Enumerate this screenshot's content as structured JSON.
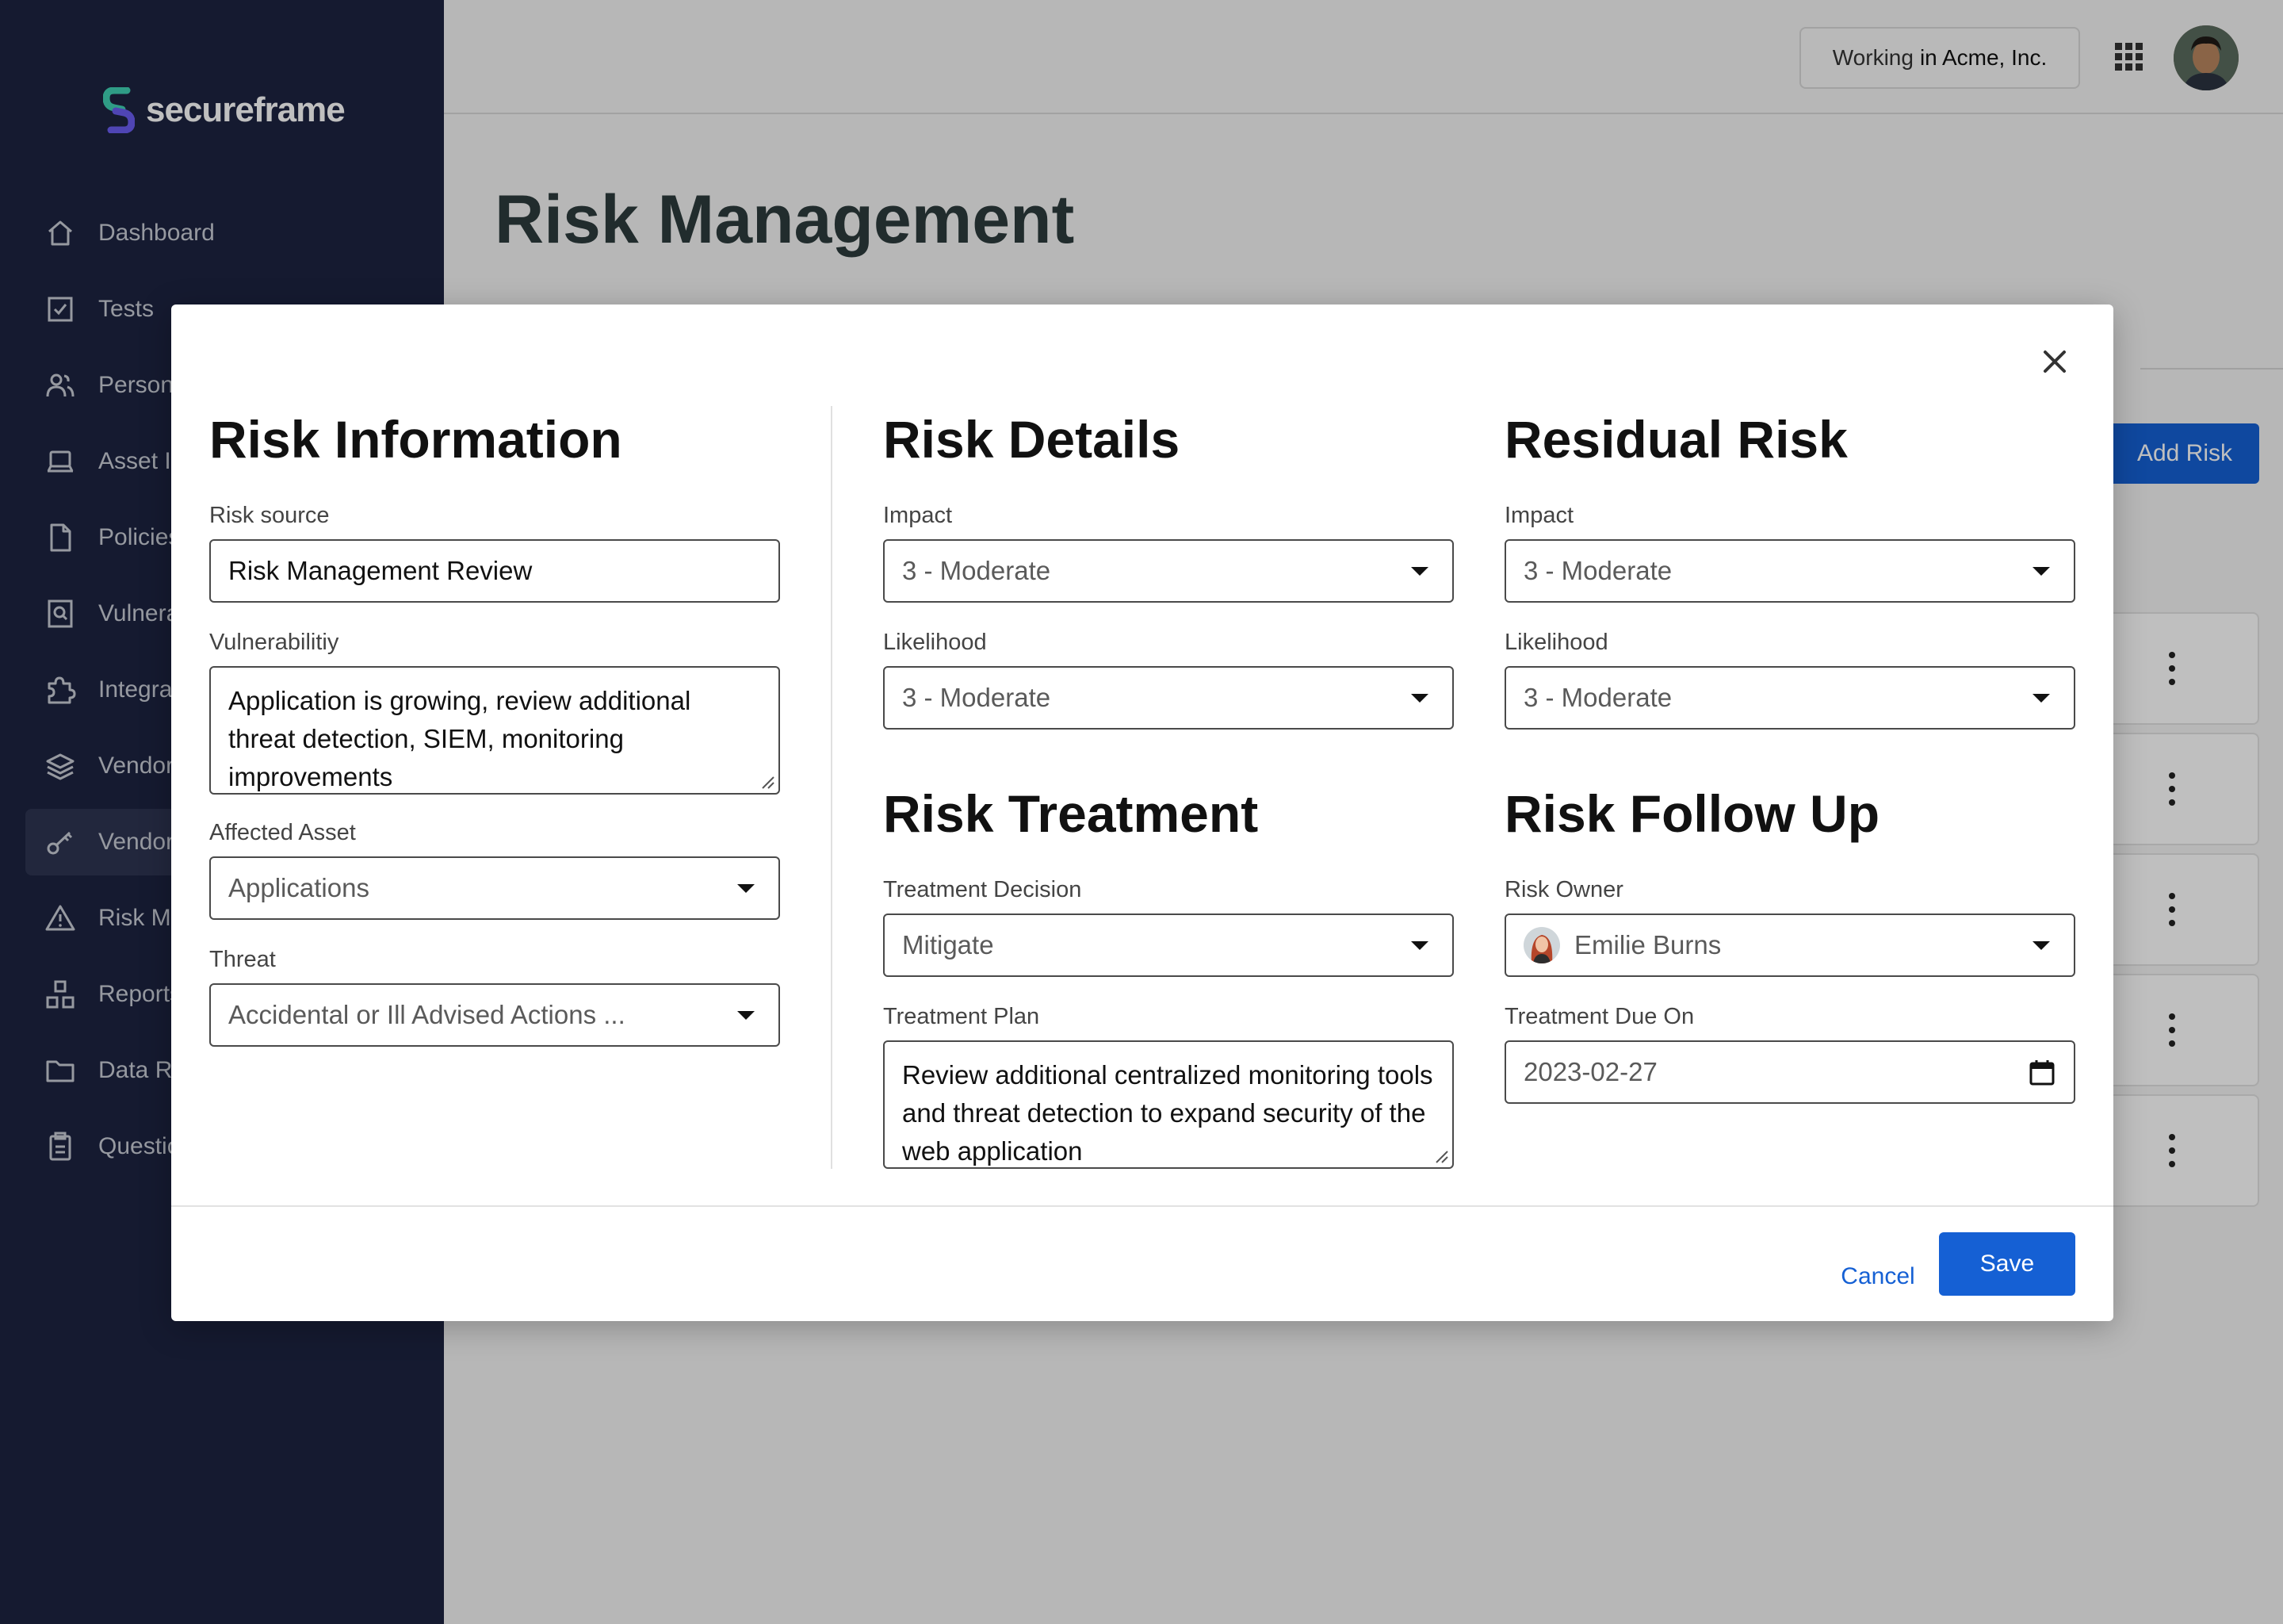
{
  "app": {
    "logo_text": "secureframe"
  },
  "sidebar": {
    "items": [
      {
        "label": "Dashboard"
      },
      {
        "label": "Tests"
      },
      {
        "label": "Personn"
      },
      {
        "label": "Asset In"
      },
      {
        "label": "Policies"
      },
      {
        "label": "Vulnera"
      },
      {
        "label": "Integra"
      },
      {
        "label": "Vendor"
      },
      {
        "label": "Vendor",
        "active": true
      },
      {
        "label": "Risk Ma"
      },
      {
        "label": "Reports"
      },
      {
        "label": "Data Ro"
      },
      {
        "label": "Questio"
      }
    ]
  },
  "header": {
    "workspace_prefix": "Working",
    "workspace_name": "in Acme, Inc."
  },
  "page": {
    "title": "Risk Management",
    "add_risk_label": "Add Risk"
  },
  "modal": {
    "risk_information": {
      "title": "Risk Information",
      "risk_source_label": "Risk source",
      "risk_source_value": "Risk Management Review",
      "vulnerability_label": "Vulnerabilitiy",
      "vulnerability_value": "Application is growing, review additional threat detection, SIEM, monitoring improvements",
      "affected_asset_label": "Affected Asset",
      "affected_asset_value": "Applications",
      "threat_label": "Threat",
      "threat_value": "Accidental or Ill Advised Actions ..."
    },
    "risk_details": {
      "title": "Risk Details",
      "impact_label": "Impact",
      "impact_value": "3 - Moderate",
      "likelihood_label": "Likelihood",
      "likelihood_value": "3 - Moderate"
    },
    "residual_risk": {
      "title": "Residual Risk",
      "impact_label": "Impact",
      "impact_value": "3 - Moderate",
      "likelihood_label": "Likelihood",
      "likelihood_value": "3 - Moderate"
    },
    "risk_treatment": {
      "title": "Risk Treatment",
      "decision_label": "Treatment Decision",
      "decision_value": "Mitigate",
      "plan_label": "Treatment Plan",
      "plan_value": "Review additional centralized monitoring tools and threat detection to expand security of the web application"
    },
    "risk_follow_up": {
      "title": "Risk Follow Up",
      "owner_label": "Risk Owner",
      "owner_value": "Emilie Burns",
      "due_label": "Treatment Due On",
      "due_value": "2023-02-27"
    },
    "cancel_label": "Cancel",
    "save_label": "Save"
  },
  "colors": {
    "sidebar_bg": "#1c2340",
    "primary": "#1560d4",
    "heading": "#111111"
  }
}
